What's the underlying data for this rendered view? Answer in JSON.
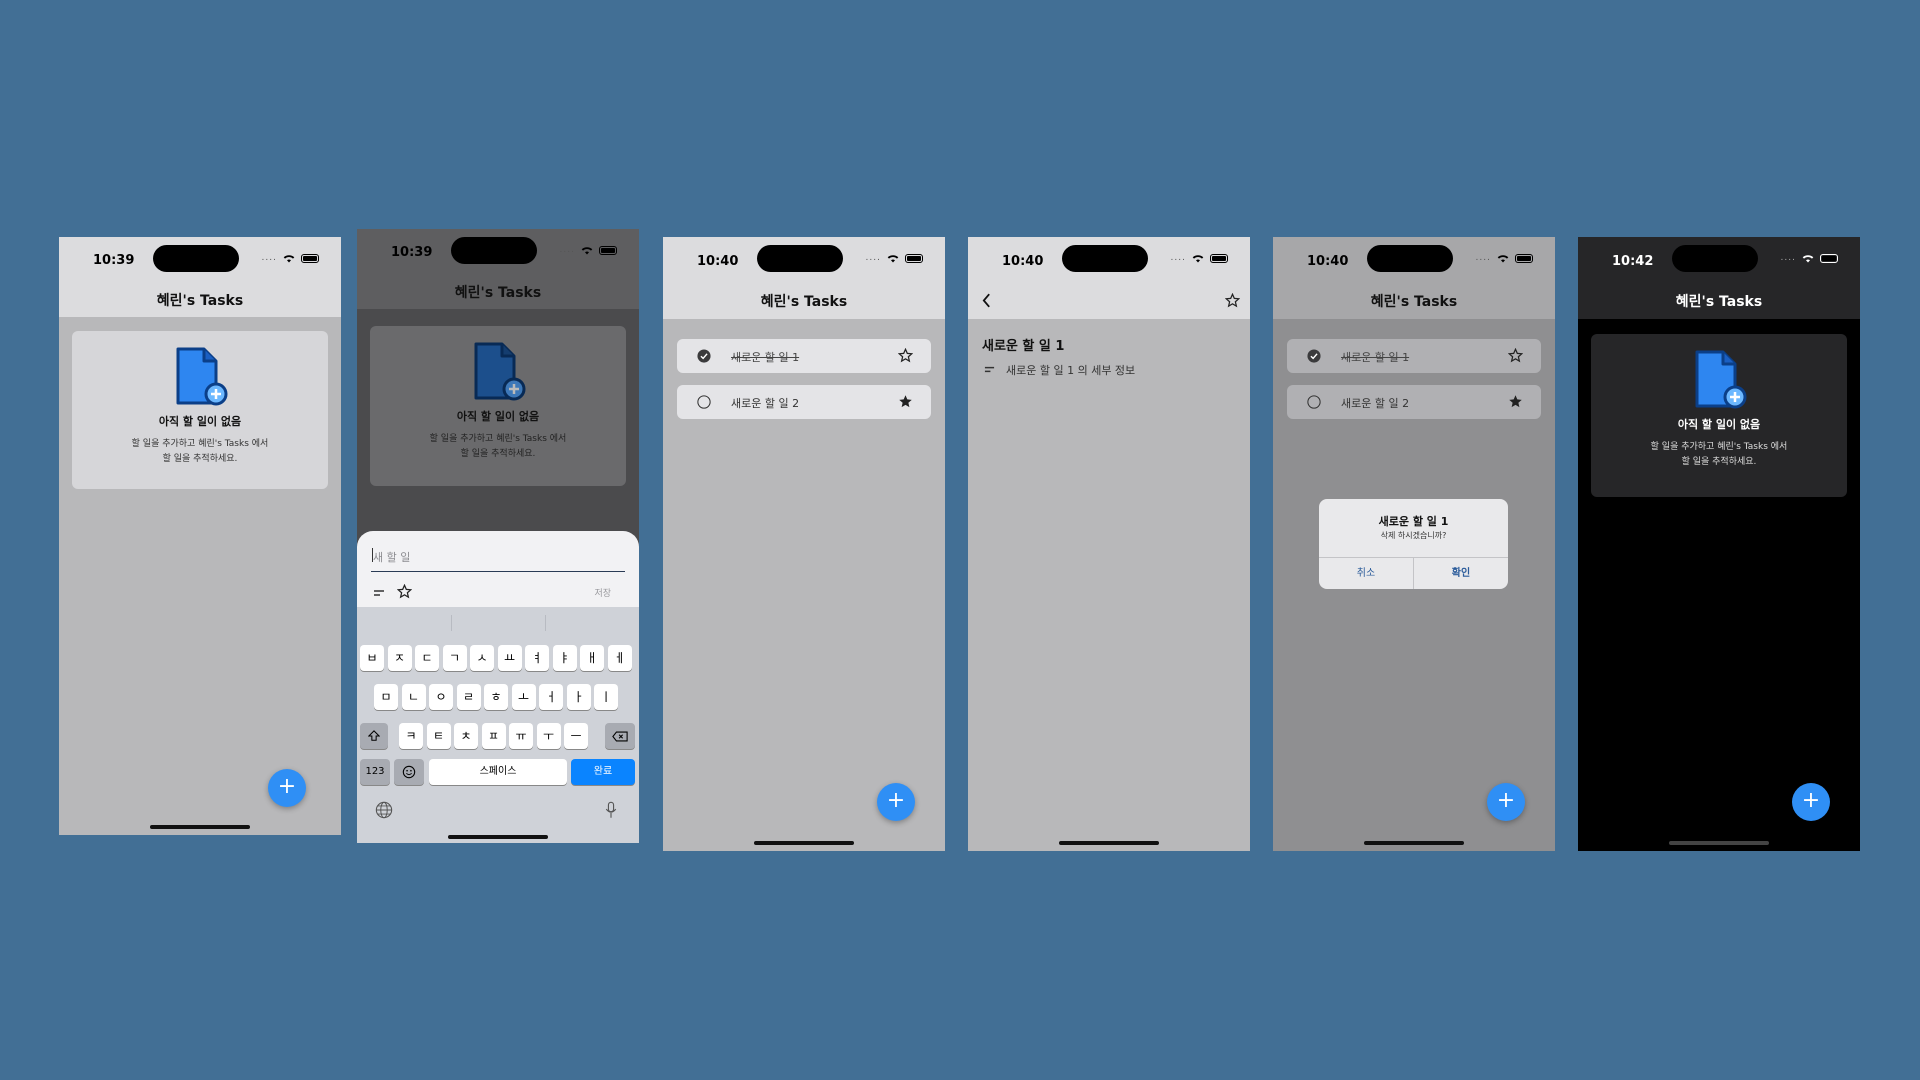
{
  "app_title": "혜린's Tasks",
  "fab_label": "+",
  "colors": {
    "background": "#426f95",
    "accent": "#2f8ff5",
    "dark_bg": "#000000"
  },
  "screens": [
    {
      "id": "empty-light",
      "time": "10:39",
      "status_dots": "....",
      "empty": {
        "title": "아직 할 일이 없음",
        "desc_line1": "할 일을 추가하고 혜린's Tasks 에서",
        "desc_line2": "할 일을 추적하세요."
      }
    },
    {
      "id": "add-sheet",
      "time": "10:39",
      "status_dots": "....",
      "empty": {
        "title": "아직 할 일이 없음",
        "desc_line1": "할 일을 추가하고 혜린's Tasks 에서",
        "desc_line2": "할 일을 추적하세요."
      },
      "sheet": {
        "placeholder": "새 할 일",
        "save_label": "저장"
      },
      "keyboard": {
        "row1": [
          "ㅂ",
          "ㅈ",
          "ㄷ",
          "ㄱ",
          "ㅅ",
          "ㅛ",
          "ㅕ",
          "ㅑ",
          "ㅐ",
          "ㅔ"
        ],
        "row2": [
          "ㅁ",
          "ㄴ",
          "ㅇ",
          "ㄹ",
          "ㅎ",
          "ㅗ",
          "ㅓ",
          "ㅏ",
          "ㅣ"
        ],
        "row3": [
          "ㅋ",
          "ㅌ",
          "ㅊ",
          "ㅍ",
          "ㅠ",
          "ㅜ",
          "ㅡ"
        ],
        "numbers_key": "123",
        "space_key": "스페이스",
        "done_key": "완료"
      }
    },
    {
      "id": "task-list",
      "time": "10:40",
      "status_dots": "....",
      "tasks": [
        {
          "label": "새로운 할 일 1",
          "completed": true,
          "starred": false
        },
        {
          "label": "새로운 할 일 2",
          "completed": false,
          "starred": true
        }
      ]
    },
    {
      "id": "task-detail",
      "time": "10:40",
      "status_dots": "....",
      "detail": {
        "title": "새로운 할 일 1",
        "notes": "새로운 할 일 1 의 세부 정보"
      }
    },
    {
      "id": "delete-alert",
      "time": "10:40",
      "status_dots": "....",
      "tasks": [
        {
          "label": "새로운 할 일 1",
          "completed": true,
          "starred": false
        },
        {
          "label": "새로운 할 일 2",
          "completed": false,
          "starred": true
        }
      ],
      "alert": {
        "title": "새로운 할 일 1",
        "message": "삭제 하시겠습니까?",
        "cancel": "취소",
        "confirm": "확인"
      }
    },
    {
      "id": "empty-dark",
      "time": "10:42",
      "status_dots": "....",
      "empty": {
        "title": "아직 할 일이 없음",
        "desc_line1": "할 일을 추가하고 혜린's Tasks 에서",
        "desc_line2": "할 일을 추적하세요."
      }
    }
  ]
}
